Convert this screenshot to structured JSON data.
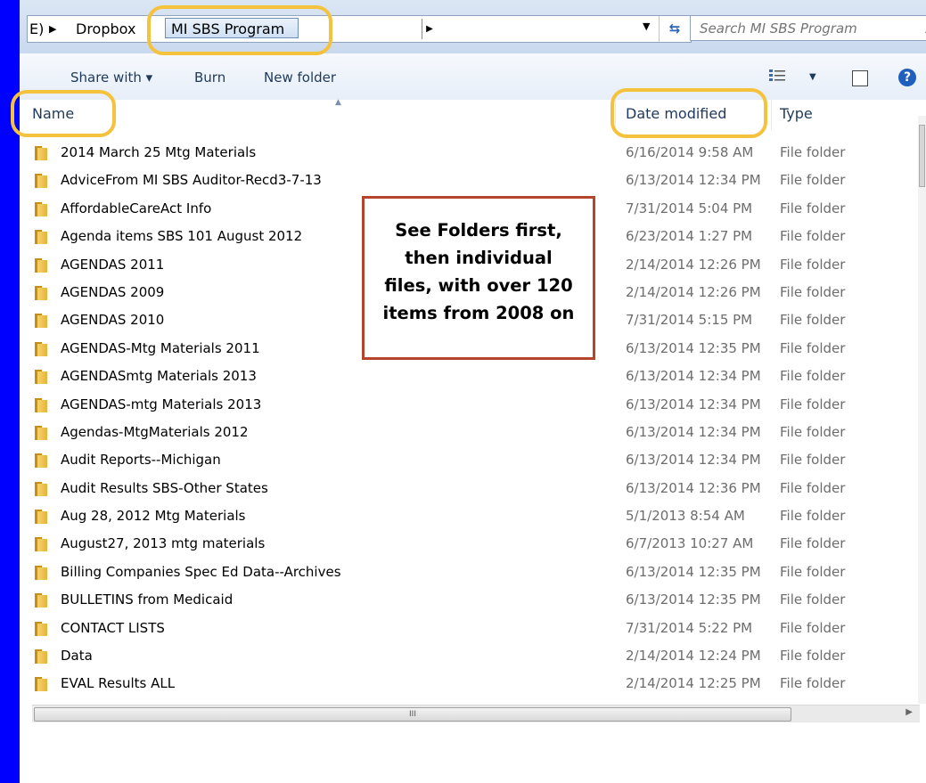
{
  "address": {
    "crumb_partial": "E)",
    "crumb_dropbox": "Dropbox",
    "crumb_current": "MI SBS Program",
    "separator": "▶"
  },
  "search": {
    "placeholder": "Search MI SBS Program"
  },
  "toolbar": {
    "share_label": "Share with ▾",
    "burn_label": "Burn",
    "new_folder_label": "New folder",
    "help_label": "?"
  },
  "columns": {
    "name": "Name",
    "date": "Date modified",
    "type": "Type"
  },
  "files": [
    {
      "name": "2014 March 25 Mtg Materials",
      "date": "6/16/2014 9:58 AM",
      "type": "File folder"
    },
    {
      "name": "AdviceFrom MI SBS Auditor-Recd3-7-13",
      "date": "6/13/2014 12:34 PM",
      "type": "File folder"
    },
    {
      "name": "AffordableCareAct Info",
      "date": "7/31/2014 5:04 PM",
      "type": "File folder"
    },
    {
      "name": "Agenda items SBS 101 August 2012",
      "date": "6/23/2014 1:27 PM",
      "type": "File folder"
    },
    {
      "name": "AGENDAS  2011",
      "date": "2/14/2014 12:26 PM",
      "type": "File folder"
    },
    {
      "name": "AGENDAS 2009",
      "date": "2/14/2014 12:26 PM",
      "type": "File folder"
    },
    {
      "name": "AGENDAS 2010",
      "date": "7/31/2014 5:15 PM",
      "type": "File folder"
    },
    {
      "name": "AGENDAS-Mtg Materials  2011",
      "date": "6/13/2014 12:35 PM",
      "type": "File folder"
    },
    {
      "name": "AGENDASmtg Materials 2013",
      "date": "6/13/2014 12:34 PM",
      "type": "File folder"
    },
    {
      "name": "AGENDAS-mtg Materials 2013",
      "date": "6/13/2014 12:34 PM",
      "type": "File folder"
    },
    {
      "name": "Agendas-MtgMaterials 2012",
      "date": "6/13/2014 12:34 PM",
      "type": "File folder"
    },
    {
      "name": "Audit Reports--Michigan",
      "date": "6/13/2014 12:34 PM",
      "type": "File folder"
    },
    {
      "name": "Audit Results SBS-Other States",
      "date": "6/13/2014 12:36 PM",
      "type": "File folder"
    },
    {
      "name": "Aug 28, 2012 Mtg Materials",
      "date": "5/1/2013 8:54 AM",
      "type": "File folder"
    },
    {
      "name": "August27, 2013 mtg materials",
      "date": "6/7/2013 10:27 AM",
      "type": "File folder"
    },
    {
      "name": "Billing Companies Spec Ed Data--Archives",
      "date": "6/13/2014 12:35 PM",
      "type": "File folder"
    },
    {
      "name": "BULLETINS from Medicaid",
      "date": "6/13/2014 12:35 PM",
      "type": "File folder"
    },
    {
      "name": "CONTACT LISTS",
      "date": "7/31/2014 5:22 PM",
      "type": "File folder"
    },
    {
      "name": "Data",
      "date": "2/14/2014 12:24 PM",
      "type": "File folder"
    },
    {
      "name": "EVAL Results ALL",
      "date": "2/14/2014 12:25 PM",
      "type": "File folder"
    }
  ],
  "callout": {
    "lines": [
      "See Folders first,",
      "then individual",
      "files, with over 120",
      "items from 2008 on"
    ]
  },
  "scrollbar": {
    "grip": "III"
  },
  "icons": {
    "folder": "folder-icon",
    "search": "search-icon",
    "refresh": "refresh-icon",
    "views": "view-options-icon",
    "preview": "preview-pane-icon",
    "help": "help-icon"
  },
  "colors": {
    "background": "#0000ff",
    "highlight": "#f5c23e",
    "callout_border": "#b5452a",
    "toolbar_text": "#1e395b"
  }
}
